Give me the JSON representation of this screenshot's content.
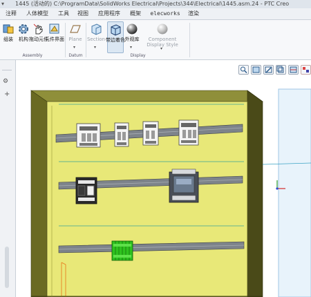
{
  "titlebar": {
    "title": "1445 (活动的) C:\\ProgramData\\SolidWorks Electrical\\Projects\\344\\Electrical\\1445.asm.24 - PTC Creo"
  },
  "tabs": [
    {
      "label": "注释"
    },
    {
      "label": "人体模型"
    },
    {
      "label": "工具"
    },
    {
      "label": "视图"
    },
    {
      "label": "应用程序"
    },
    {
      "label": "概架"
    },
    {
      "label": "elecworks"
    },
    {
      "label": "渲染"
    }
  ],
  "ribbon": {
    "assemble": {
      "label": "组装"
    },
    "mechanism": {
      "label": "机构"
    },
    "drag": {
      "label": "拖动元件"
    },
    "component_interface": {
      "label": "元件界面"
    },
    "plane": {
      "label": "Plane"
    },
    "section": {
      "label": "Section"
    },
    "shading_edges": {
      "label": "带边着色"
    },
    "appearance": {
      "label": "外观库"
    },
    "component_display_style": {
      "label": "Component Display Style"
    },
    "groups": {
      "assembly": "Assembly",
      "datum": "Datum",
      "display": "Display"
    }
  },
  "colors": {
    "panel_back": "#e8e878",
    "panel_frame": "#6a6a1e",
    "rail": "#7d838a",
    "sky": "#e8f3fb",
    "terminal": "#2ec21e"
  }
}
